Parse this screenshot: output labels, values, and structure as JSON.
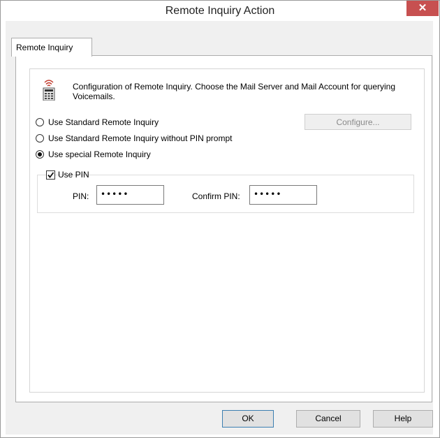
{
  "window": {
    "title": "Remote Inquiry Action",
    "close_glyph": "✕"
  },
  "tabs": [
    {
      "label": "Remote Inquiry"
    }
  ],
  "info": {
    "icon": "phone-keypad-icon",
    "text": "Configuration of Remote Inquiry. Choose the Mail Server and Mail Account for querying Voicemails."
  },
  "options": [
    {
      "label": "Use Standard Remote Inquiry",
      "selected": false
    },
    {
      "label": "Use Standard Remote Inquiry without PIN prompt",
      "selected": false
    },
    {
      "label": "Use special Remote Inquiry",
      "selected": true
    }
  ],
  "configure_button": {
    "label": "Configure...",
    "enabled": false
  },
  "pin_group": {
    "checkbox_label": "Use PIN",
    "checked": true,
    "pin_label": "PIN:",
    "pin_value": "•••••",
    "confirm_label": "Confirm PIN:",
    "confirm_value": "•••••"
  },
  "footer": {
    "ok": "OK",
    "cancel": "Cancel",
    "help": "Help"
  },
  "colors": {
    "close_button": "#c75050",
    "dialog_bg": "#f0f0f0",
    "disabled_text": "#8a8a8a"
  }
}
